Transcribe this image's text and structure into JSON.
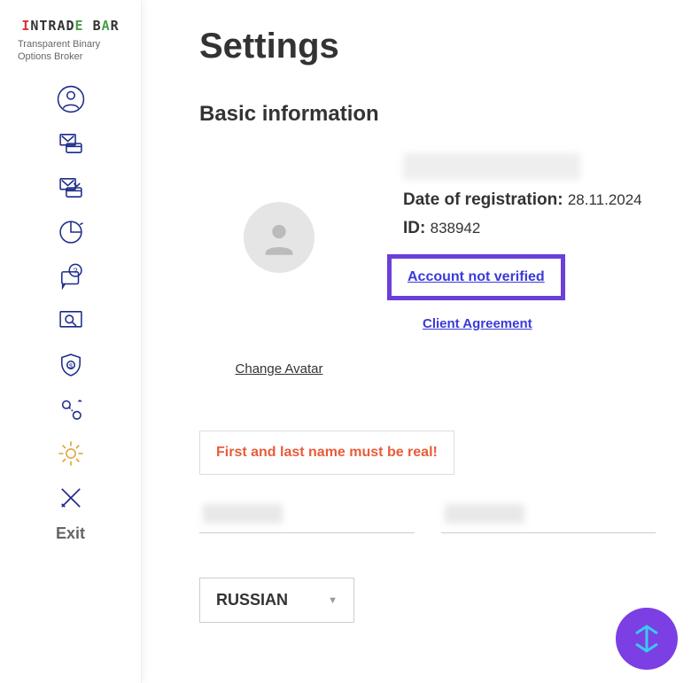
{
  "logo": {
    "text": "INTRADE",
    "suffix": "BAR"
  },
  "tagline": "Transparent Binary Options Broker",
  "exit_label": "Exit",
  "page_title": "Settings",
  "section_title": "Basic information",
  "avatar": {
    "change_label": "Change Avatar"
  },
  "info": {
    "reg_label": "Date of registration:",
    "reg_value": "28.11.2024",
    "id_label": "ID:",
    "id_value": "838942",
    "verify_label": "Account not verified",
    "agreement_label": "Client Agreement"
  },
  "warning": "First and last name must be real!",
  "language": {
    "selected": "RUSSIAN"
  },
  "colors": {
    "highlight_border": "#6b3fd9",
    "link": "#3a3ad9",
    "warning": "#e85c3a",
    "fab": "#7b3fe4",
    "nav_icon": "#1b2a8a",
    "gear": "#e0a030"
  }
}
